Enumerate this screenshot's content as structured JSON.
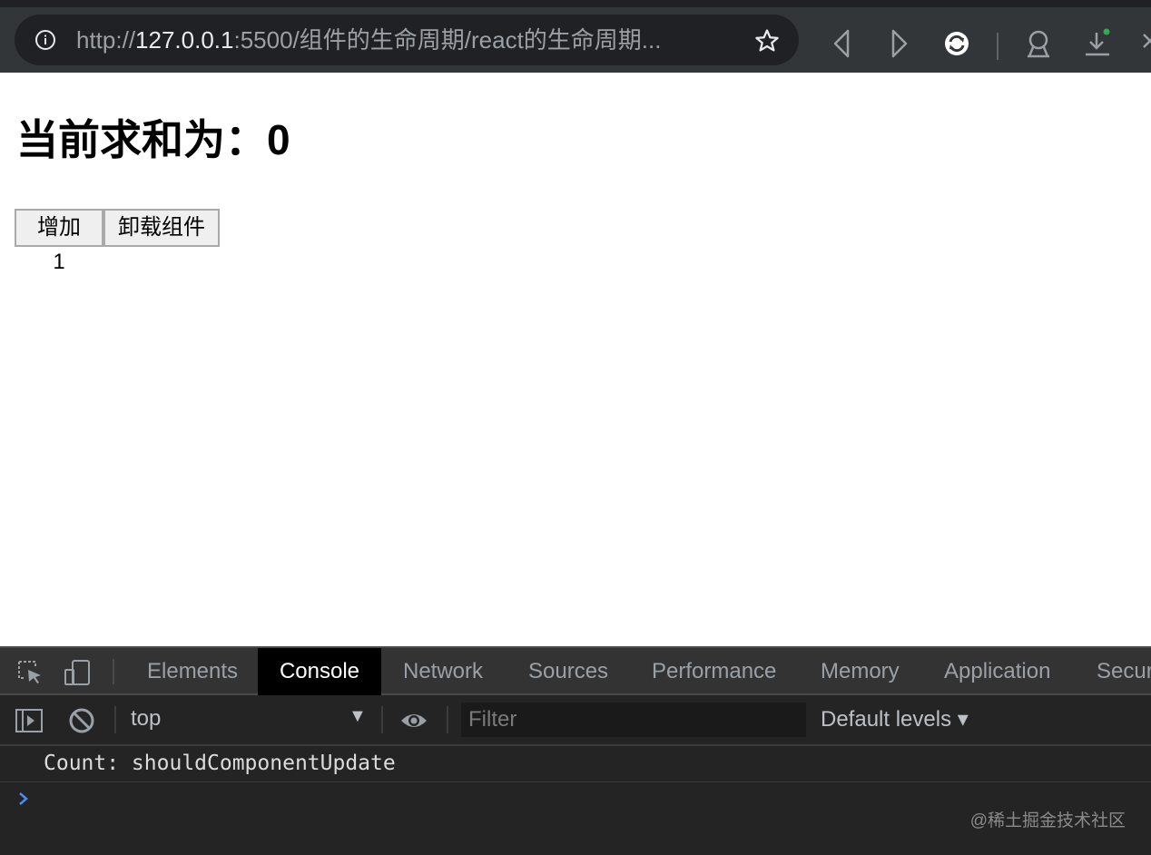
{
  "browser": {
    "url_scheme": "http://",
    "url_host": "127.0.0.1",
    "url_rest": ":5500/组件的生命周期/react的生命周期...",
    "icons": [
      "info-icon",
      "star-icon",
      "back-icon",
      "forward-icon",
      "reload-icon",
      "profile-icon",
      "download-icon",
      "close-icon"
    ]
  },
  "page": {
    "title": "当前求和为：0",
    "buttons": {
      "increment": "增加 1",
      "unmount": "卸载组件"
    }
  },
  "devtools": {
    "tabs": [
      "Elements",
      "Console",
      "Network",
      "Sources",
      "Performance",
      "Memory",
      "Application",
      "Secur"
    ],
    "active_tab": "Console",
    "context": "top",
    "filter_placeholder": "Filter",
    "levels": "Default levels ▾",
    "log_entries": [
      "Count: shouldComponentUpdate"
    ],
    "prompt_symbol": "›"
  },
  "watermark": "@稀土掘金技术社区",
  "colors": {
    "chrome_bg": "#323639",
    "urlbar_bg": "#202124",
    "devtools_bg": "#242424",
    "active_tab_bg": "#000000",
    "download_dot": "#34a853",
    "prompt": "#4a8bf5"
  }
}
